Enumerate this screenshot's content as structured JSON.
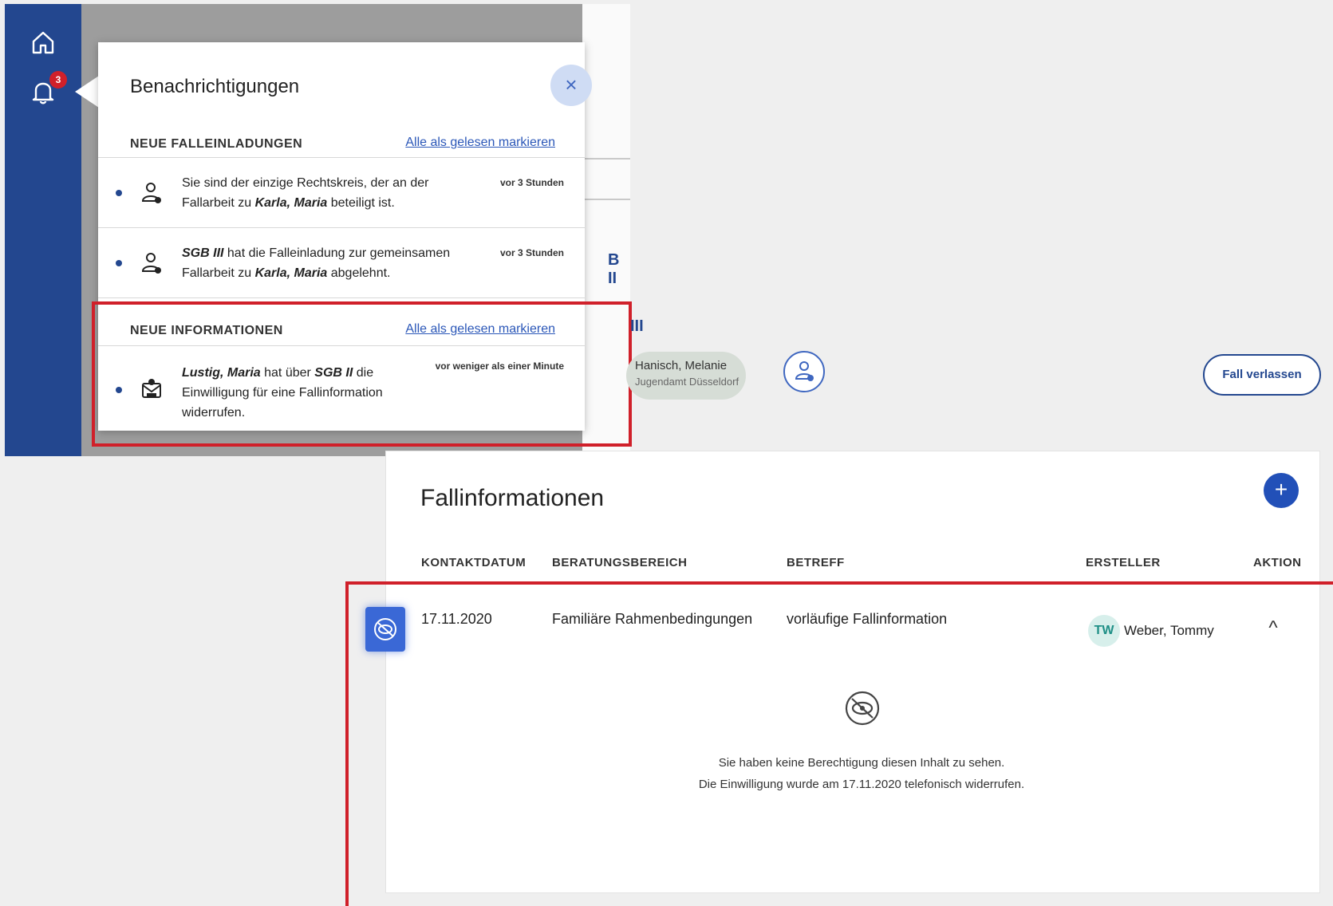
{
  "notifications_panel": {
    "title": "Benachrichtigungen",
    "badge_count": "3",
    "close_symbol": "×",
    "section_invitations": {
      "heading": "NEUE FALLEINLADUNGEN",
      "mark_read": "Alle als gelesen markieren",
      "items": [
        {
          "icon": "person-icon",
          "time": "vor 3 Stunden",
          "line1": "Sie sind der einzige Rechtskreis, der an der",
          "line2_pre": "Fallarbeit zu ",
          "line2_em": "Karla, Maria",
          "line2_post": " beteiligt ist."
        },
        {
          "icon": "person-icon",
          "time": "vor 3 Stunden",
          "line1_em": "SGB III",
          "line1_post": " hat die Falleinladung zur gemeinsamen",
          "line2_pre": "Fallarbeit zu ",
          "line2_em": "Karla, Maria",
          "line2_post": " abgelehnt."
        }
      ]
    },
    "section_information": {
      "heading": "NEUE INFORMATIONEN",
      "mark_read": "Alle als gelesen markieren",
      "items": [
        {
          "icon": "consent-revoked-icon",
          "time": "vor weniger als einer Minute",
          "line1_em1": "Lustig, Maria",
          "line1_mid": " hat über ",
          "line1_em2": "SGB II",
          "line1_post": " die",
          "line2": "Einwilligung für eine Fallinformation",
          "line3": "widerrufen."
        }
      ]
    }
  },
  "background": {
    "partial_label_1": "B II",
    "partial_label_2": "III"
  },
  "participants": {
    "name": "Hanisch, Melanie",
    "org": "Jugendamt Düsseldorf",
    "leave_label": "Fall verlassen"
  },
  "fallinfo": {
    "title": "Fallinformationen",
    "add_symbol": "+",
    "columns": [
      "KONTAKTDATUM",
      "BERATUNGSBEREICH",
      "BETREFF",
      "ERSTELLER",
      "AKTION"
    ],
    "row": {
      "date": "17.11.2020",
      "area": "Familiäre Rahmenbedingungen",
      "subject": "vorläufige Fallinformation",
      "creator_initials": "TW",
      "creator": "Weber, Tommy",
      "action_symbol": "^"
    },
    "hidden_message_1": "Sie haben keine Berechtigung diesen Inhalt zu sehen.",
    "hidden_message_2": "Die Einwilligung wurde am 17.11.2020 telefonisch widerrufen."
  },
  "colors": {
    "sidebar": "#23478f",
    "highlight": "#d0202a",
    "accent": "#2250b8"
  }
}
